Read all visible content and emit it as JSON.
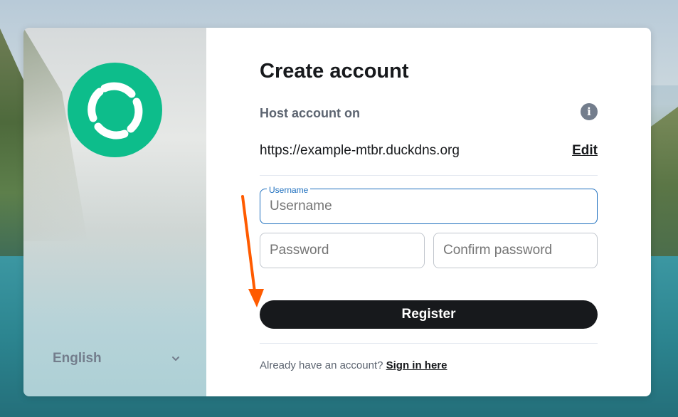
{
  "sidebar": {
    "language": "English"
  },
  "form": {
    "title": "Create account",
    "host_label": "Host account on",
    "host_url": "https://example-mtbr.duckdns.org",
    "edit_label": "Edit",
    "username_legend": "Username",
    "username_placeholder": "Username",
    "password_placeholder": "Password",
    "confirm_password_placeholder": "Confirm password",
    "register_label": "Register",
    "footer_text": "Already have an account? ",
    "signin_label": "Sign in here"
  },
  "colors": {
    "brand": "#0dbd8b",
    "focus": "#1e6fbe",
    "primary_button": "#17191c",
    "annotation_arrow": "#ff5b00"
  }
}
